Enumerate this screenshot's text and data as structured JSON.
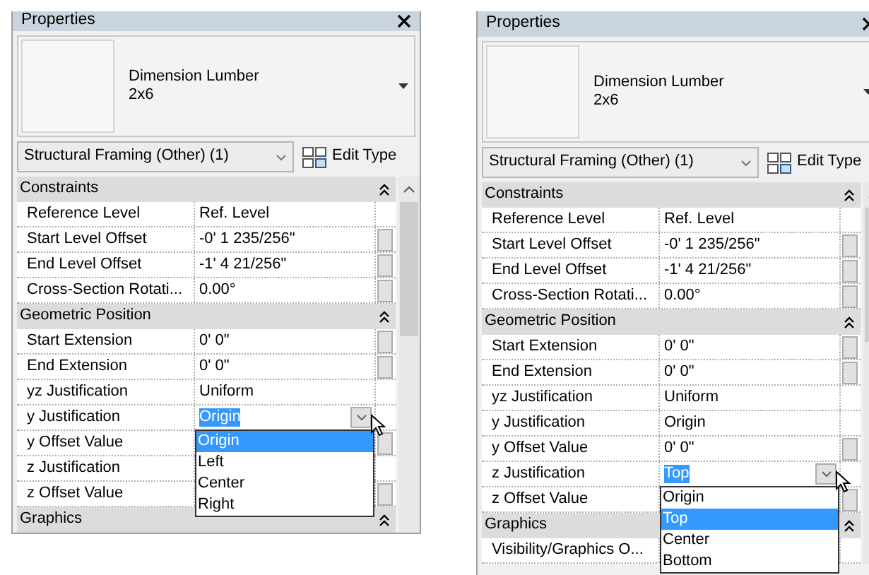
{
  "panels": [
    {
      "title": "Properties",
      "type_name": "Dimension Lumber",
      "type_size": "2x6",
      "selector": "Structural Framing (Other) (1)",
      "edit_type": "Edit Type",
      "groups": [
        {
          "name": "Constraints",
          "expanded": true,
          "properties": [
            {
              "label": "Reference Level",
              "value": "Ref. Level",
              "param_button": false
            },
            {
              "label": "Start Level Offset",
              "value": "-0'  1 235/256\"",
              "param_button": true
            },
            {
              "label": "End Level Offset",
              "value": "-1'  4 21/256\"",
              "param_button": true
            },
            {
              "label": "Cross-Section Rotati...",
              "value": "0.00°",
              "param_button": true
            }
          ]
        },
        {
          "name": "Geometric Position",
          "expanded": true,
          "properties": [
            {
              "label": "Start Extension",
              "value": "0'  0\"",
              "param_button": true
            },
            {
              "label": "End Extension",
              "value": "0'  0\"",
              "param_button": true
            },
            {
              "label": "yz Justification",
              "value": "Uniform",
              "param_button": false
            },
            {
              "label": "y Justification",
              "value": "Origin",
              "param_button": false,
              "editing": true,
              "options": [
                {
                  "label": "Origin",
                  "selected": true
                },
                {
                  "label": "Left",
                  "selected": false
                },
                {
                  "label": "Center",
                  "selected": false
                },
                {
                  "label": "Right",
                  "selected": false
                }
              ]
            },
            {
              "label": "y Offset Value",
              "param_button": true
            },
            {
              "label": "z Justification",
              "param_button": false
            },
            {
              "label": "z Offset Value",
              "param_button": true
            }
          ]
        },
        {
          "name": "Graphics",
          "expanded": true
        }
      ]
    },
    {
      "title": "Properties",
      "type_name": "Dimension Lumber",
      "type_size": "2x6",
      "selector": "Structural Framing (Other) (1)",
      "edit_type": "Edit Type",
      "groups": [
        {
          "name": "Constraints",
          "expanded": true,
          "properties": [
            {
              "label": "Reference Level",
              "value": "Ref. Level",
              "param_button": false
            },
            {
              "label": "Start Level Offset",
              "value": "-0'  1 235/256\"",
              "param_button": true
            },
            {
              "label": "End Level Offset",
              "value": "-1'  4 21/256\"",
              "param_button": true
            },
            {
              "label": "Cross-Section Rotati...",
              "value": "0.00°",
              "param_button": true
            }
          ]
        },
        {
          "name": "Geometric Position",
          "expanded": true,
          "properties": [
            {
              "label": "Start Extension",
              "value": "0'  0\"",
              "param_button": true
            },
            {
              "label": "End Extension",
              "value": "0'  0\"",
              "param_button": true
            },
            {
              "label": "yz Justification",
              "value": "Uniform",
              "param_button": false
            },
            {
              "label": "y Justification",
              "value": "Origin",
              "param_button": false
            },
            {
              "label": "y Offset Value",
              "value": "0'  0\"",
              "param_button": true
            },
            {
              "label": "z Justification",
              "value": "Top",
              "param_button": false,
              "editing": true,
              "options": [
                {
                  "label": "Origin",
                  "selected": false
                },
                {
                  "label": "Top",
                  "selected": true
                },
                {
                  "label": "Center",
                  "selected": false
                },
                {
                  "label": "Bottom",
                  "selected": false
                }
              ]
            },
            {
              "label": "z Offset Value",
              "param_button": true
            }
          ]
        },
        {
          "name": "Graphics",
          "expanded": true,
          "properties": [
            {
              "label": "Visibility/Graphics O...",
              "param_button": false
            }
          ]
        }
      ]
    }
  ]
}
